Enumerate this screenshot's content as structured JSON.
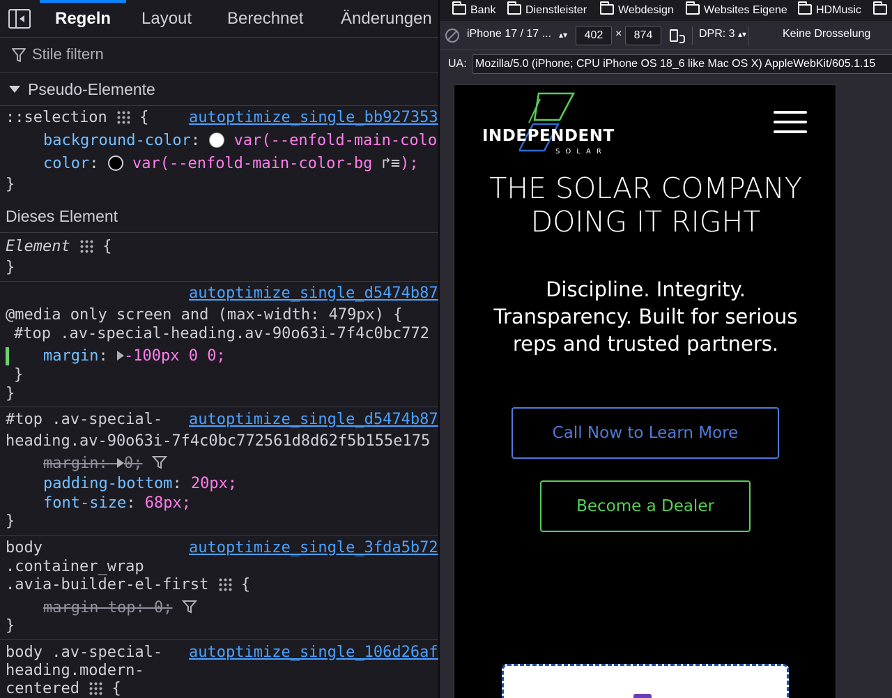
{
  "devtools": {
    "tabs": [
      "Regeln",
      "Layout",
      "Berechnet",
      "Änderungen"
    ],
    "filter_placeholder": "Stile filtern",
    "pseudo_header": "Pseudo-Elemente",
    "this_element_header": "Dieses Element",
    "rules": {
      "selection": {
        "selector": "::selection",
        "brace_open": "{",
        "source": "autoptimize_single_bb927353",
        "decl1_prop": "background-color",
        "decl1_val": "var(--enfold-main-color",
        "decl2_prop": "color",
        "decl2_val": "var(--enfold-main-color-bg",
        "decl2_jump": "↱≡",
        "decl2_close": ");",
        "brace_close": "}"
      },
      "element": {
        "selector": "Element",
        "brace_open": "{",
        "brace_close": "}"
      },
      "media": {
        "source": "autoptimize_single_d5474b87",
        "media_query": "@media only screen and (max-width: 479px) {",
        "selector": "#top .av-special-heading.av-90o63i-7f4c0bc772",
        "decl_prop": "margin",
        "decl_val": "-100px 0 0;",
        "inner_close": "}",
        "outer_close": "}"
      },
      "heading": {
        "selector_line1": "#top .av-special-",
        "selector_line2": "heading.av-90o63i-7f4c0bc772561d8d62f5b155e175",
        "source": "autoptimize_single_d5474b87",
        "decl1": "margin: ",
        "decl1_val": "0;",
        "decl2_prop": "padding-bottom",
        "decl2_val": "20px;",
        "decl3_prop": "font-size",
        "decl3_val": "68px;",
        "brace_close": "}"
      },
      "body_container": {
        "selector_line1": "body",
        "selector_line2": ".container_wrap",
        "selector_line3": ".avia-builder-el-first",
        "brace_open": "{",
        "source": "autoptimize_single_3fda5b72",
        "decl1": "margin-top: 0;",
        "brace_close": "}"
      },
      "body_heading": {
        "selector_line1": "body .av-special-",
        "selector_line2": "heading.modern-",
        "selector_line3": "centered",
        "brace_open": "{",
        "source": "autoptimize_single_106d26af"
      }
    }
  },
  "browser": {
    "bookmarks": [
      "Bank",
      "Dienstleister",
      "Webdesign",
      "Websites Eigene",
      "HDMusic"
    ],
    "device_name": "iPhone 17 / 17 ...",
    "width": "402",
    "times": "×",
    "height": "874",
    "dpr": "DPR: 3",
    "throttle": "Keine Drosselung",
    "ua_label": "UA:",
    "ua_value": "Mozilla/5.0 (iPhone; CPU iPhone OS 18_6 like Mac OS X) AppleWebKit/605.1.15"
  },
  "site": {
    "logo_word": "INDEPENDENT",
    "logo_sub": "SOLAR",
    "hero_title": "THE SOLAR COMPANY DOING IT RIGHT",
    "hero_subtitle": "Discipline. Integrity. Transparency. Built for serious reps and trusted partners.",
    "cta_call": "Call Now to Learn More",
    "cta_dealer": "Become a Dealer"
  },
  "colors": {
    "accent_tab": "#0a84ff",
    "prop": "#75bfff",
    "value": "#ff7de9",
    "link": "#4aa2ff",
    "cta_blue": "#4f7bd9",
    "cta_green": "#56d154"
  }
}
